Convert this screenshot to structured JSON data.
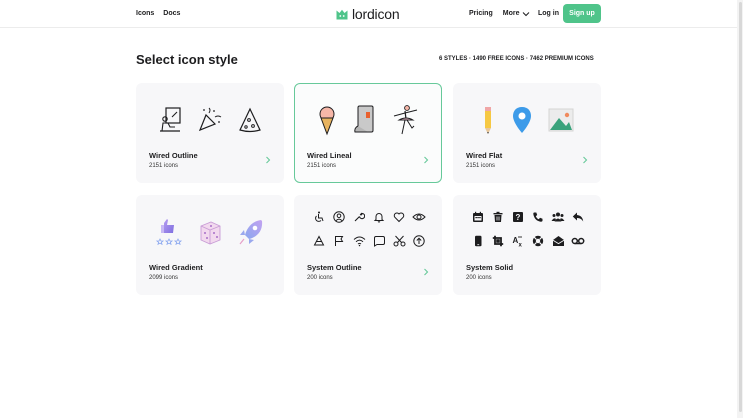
{
  "nav": {
    "icons": "Icons",
    "docs": "Docs",
    "pricing": "Pricing",
    "more": "More",
    "login": "Log in",
    "signup": "Sign up"
  },
  "brand": {
    "name": "lordicon",
    "color": "#4fc48a"
  },
  "heading": {
    "title": "Select icon style",
    "stats": "6 STYLES · 1490 FREE ICONS · 7462 PREMIUM ICONS"
  },
  "cards": [
    {
      "title": "Wired Outline",
      "count": "2151 icons"
    },
    {
      "title": "Wired Lineal",
      "count": "2151 icons"
    },
    {
      "title": "Wired Flat",
      "count": "2151 icons"
    },
    {
      "title": "Wired Gradient",
      "count": "2099 icons"
    },
    {
      "title": "System Outline",
      "count": "200 icons"
    },
    {
      "title": "System Solid",
      "count": "200 icons"
    }
  ],
  "accent_color": "#67c99a"
}
